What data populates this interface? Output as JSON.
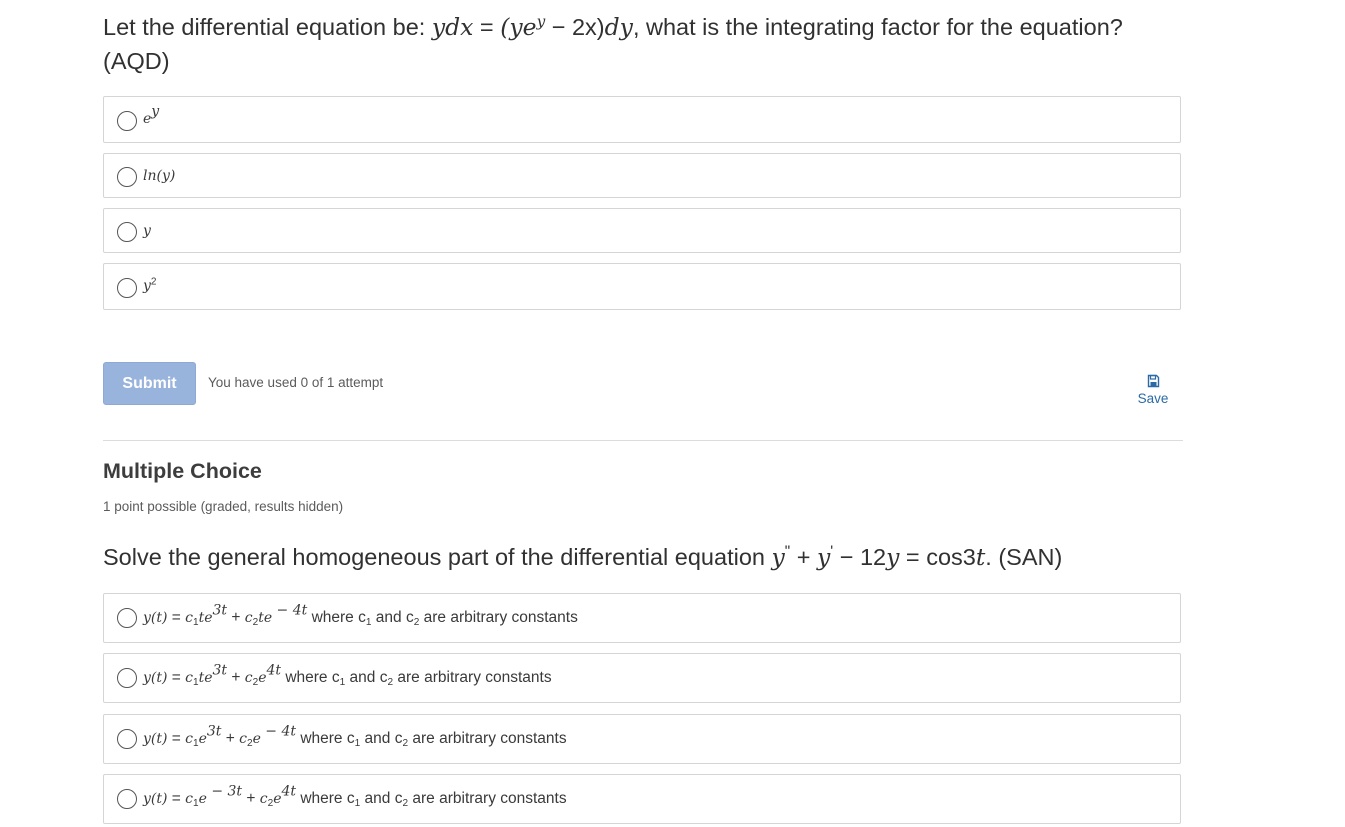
{
  "question1": {
    "prefix": "Let the differential equation be: ",
    "equation": {
      "lhs": "ydx",
      "equals": " = ",
      "open": "(ye",
      "exp": "y",
      "minus": " − 2x)",
      "dy": "dy"
    },
    "suffix": ", what is the integrating factor for the equation?",
    "tag": "(AQD)",
    "options": [
      {
        "base": "e",
        "exp": "y"
      },
      {
        "text": "ln(y)"
      },
      {
        "text": "y"
      },
      {
        "base": "y",
        "exp": "2"
      }
    ]
  },
  "controls": {
    "submit_label": "Submit",
    "attempts_text": "You have used 0 of 1 attempt",
    "save_label": "Save",
    "save_icon": "floppy-disk-icon"
  },
  "question2": {
    "section_title": "Multiple Choice",
    "points_text": "1 point possible (graded, results hidden)",
    "prompt": "Solve the general homogeneous part of the differential equation ",
    "eq": {
      "y1": "y",
      "pp": "\"",
      "plus": " + ",
      "y2": "y",
      "p": "'",
      "minus": " − 12",
      "y3": "y",
      "eqs": " = cos3",
      "t": "t",
      "end": ". (SAN)"
    },
    "option_lhs": "y(t)",
    "option_eq": " = ",
    "option_suffix": " where c",
    "option_and": " and c",
    "option_tail": " are arbitrary constants",
    "sub1": "1",
    "sub2": "2",
    "options": [
      {
        "t1": "te",
        "e1": "3t",
        "t2": "te",
        "e2": " − 4t"
      },
      {
        "t1": "te",
        "e1": "3t",
        "t2": "e",
        "e2": "4t"
      },
      {
        "t1": "e",
        "e1": "3t",
        "t2": "e",
        "e2": " − 4t"
      },
      {
        "t1": "e",
        "e1": " − 3t",
        "t2": "e",
        "e2": "4t"
      }
    ]
  }
}
